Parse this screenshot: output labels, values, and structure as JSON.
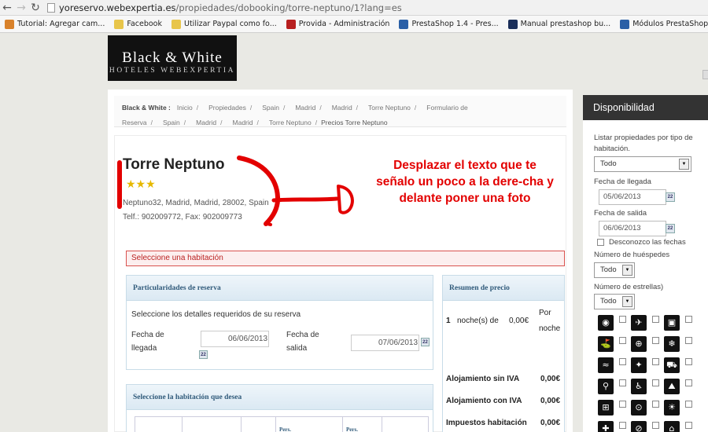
{
  "browser": {
    "url_host": "yoreservo.webexpertia.es",
    "url_path": "/propiedades/dobooking/torre-neptuno/1?lang=es",
    "bookmarks": [
      {
        "label": "Tutorial: Agregar cam...",
        "color": "#d9822b"
      },
      {
        "label": "Facebook",
        "color": "#e8c54a"
      },
      {
        "label": "Utilizar Paypal como fo...",
        "color": "#e8c54a"
      },
      {
        "label": "Provida - Administración",
        "color": "#b82020"
      },
      {
        "label": "PrestaShop 1.4 - Pres...",
        "color": "#2a5fa6"
      },
      {
        "label": "Manual prestashop bu...",
        "color": "#1b2f5a"
      },
      {
        "label": "Módulos PrestaShop - ...",
        "color": "#2a5fa6"
      },
      {
        "label": "mejores modulos prest...",
        "color": "#cfcfcf"
      }
    ]
  },
  "logo": {
    "line1": "Black & White",
    "line2": "HOTELES WEBEXPERTIA"
  },
  "breadcrumb": {
    "prefix": "Black & White :",
    "items": [
      "Inicio",
      "Propiedades",
      "Spain",
      "Madrid",
      "Madrid",
      "Torre Neptuno",
      "Formulario de Reserva",
      "Spain",
      "Madrid",
      "Madrid",
      "Torre Neptuno"
    ],
    "last": "Precios Torre Neptuno"
  },
  "hotel": {
    "name": "Torre Neptuno",
    "stars": "★★★",
    "address": "Neptuno32, Madrid, Madrid, 28002, Spain",
    "phone": "Telf.: 902009772, Fax: 902009773"
  },
  "annotation": "Desplazar el texto que te señalo un poco a la dere-cha y delante poner una foto",
  "alert": "Seleccione una habitación",
  "booking_panel": {
    "title": "Particularidades de reserva",
    "lead": "Seleccione los detalles requeridos de su reserva",
    "arrival_label_1": "Fecha de",
    "arrival_label_2": "llegada",
    "arrival_value": "06/06/2013",
    "departure_label_1": "Fecha de",
    "departure_label_2": "salida",
    "departure_value": "07/06/2013"
  },
  "price_panel": {
    "title": "Resumen de precio",
    "nights_count": "1",
    "nights_label": "noche(s) de",
    "nights_price": "0,00€",
    "per_1": "Por",
    "per_2": "noche",
    "rows": [
      {
        "label": "Alojamiento sin IVA",
        "value": "0,00€"
      },
      {
        "label": "Alojamiento con IVA",
        "value": "0,00€"
      },
      {
        "label": "Impuestos habitación",
        "value": "0,00€"
      }
    ]
  },
  "room_panel": {
    "title": "Seleccione la habitación que desea",
    "col_a": "Pers.",
    "col_b": "Pers."
  },
  "sidebar": {
    "title": "Disponibilidad",
    "type_label_1": "Listar propiedades por tipo de",
    "type_label_2": "habitación.",
    "type_value": "Todo",
    "arrival_label": "Fecha de llegada",
    "arrival_value": "05/06/2013",
    "departure_label": "Fecha de salida",
    "departure_value": "06/06/2013",
    "unknown_dates": "Desconozco las fechas",
    "guests_label": "Número de huéspedes",
    "guests_value": "Todo",
    "stars_label": "Número de estrellas)",
    "stars_value": "Todo",
    "facility_icons": [
      "nightlife-icon",
      "airport-icon",
      "laundry-icon",
      "golf-icon",
      "restaurant-icon",
      "ski-icon",
      "swimming-icon",
      "gym-icon",
      "car-icon",
      "bicycle-icon",
      "wheelchair-icon",
      "hiking-icon",
      "parking-icon",
      "stroller-icon",
      "beach-icon",
      "fitness-icon",
      "tennis-icon",
      "bar-icon"
    ]
  }
}
